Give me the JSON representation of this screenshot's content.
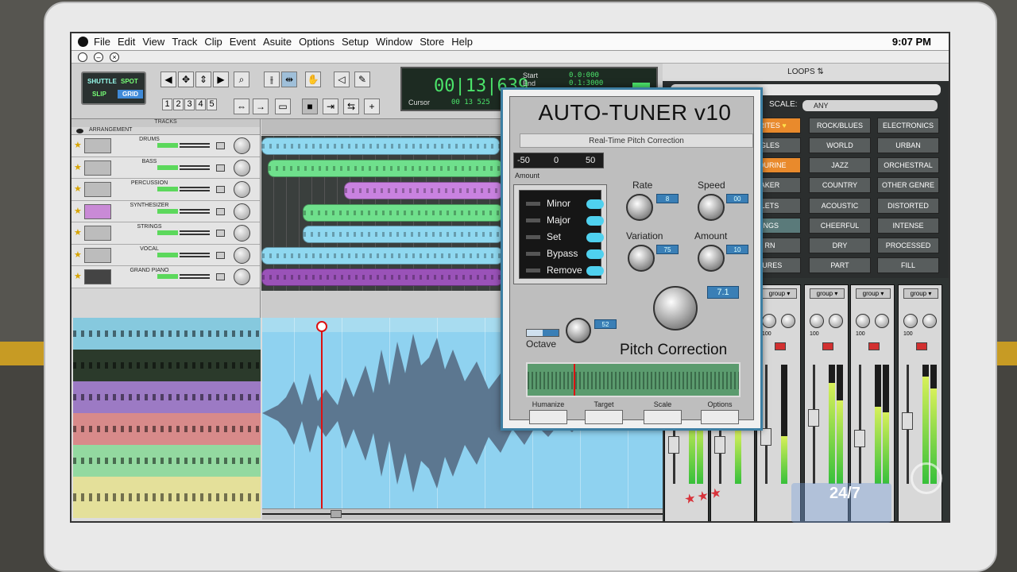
{
  "menubar": {
    "items": [
      "File",
      "Edit",
      "View",
      "Track",
      "Clip",
      "Event",
      "Asuite",
      "Options",
      "Setup",
      "Window",
      "Store",
      "Help"
    ],
    "clock": "9:07 PM"
  },
  "toolbar": {
    "modes": [
      "SHUTTLE",
      "SPOT",
      "SLIP",
      "GRID"
    ],
    "numbers": [
      "1",
      "2",
      "3",
      "4",
      "5"
    ],
    "lcd": {
      "main": "00|13|639",
      "start_label": "Start",
      "end_label": "End",
      "cursor_label": "Cursor"
    }
  },
  "tracks": {
    "header": "TRACKS",
    "arrangement_label": "ARRANGEMENT",
    "items": [
      {
        "name": "DRUMS"
      },
      {
        "name": "BASS"
      },
      {
        "name": "PERCUSSION"
      },
      {
        "name": "SYNTHESIZER"
      },
      {
        "name": "STRINGS"
      },
      {
        "name": "VOCAL"
      },
      {
        "name": "GRAND PIANO"
      }
    ]
  },
  "loops": {
    "title": "LOOPS",
    "scale_label": "SCALE:",
    "scale_value": "ANY",
    "col1": [
      "ORITES",
      "GLES",
      "BOURINE",
      "AKER",
      "LETS",
      "INGS",
      "RN",
      "TURES"
    ],
    "col2": [
      "ROCK/BLUES",
      "WORLD",
      "JAZZ",
      "COUNTRY",
      "ACOUSTIC",
      "CHEERFUL",
      "DRY",
      "PART"
    ],
    "col3": [
      "ELECTRONICS",
      "URBAN",
      "ORCHESTRAL",
      "OTHER GENRE",
      "DISTORTED",
      "INTENSE",
      "PROCESSED",
      "FILL"
    ]
  },
  "mixer": {
    "group_label": "group",
    "pan_values": [
      "100",
      "100",
      "100",
      "100"
    ]
  },
  "plugin": {
    "title": "AUTO-TUNER v10",
    "subtitle": "Real-Time Pitch Correction",
    "amount_min": "-50",
    "amount_val": "0",
    "amount_max": "50",
    "amount_label": "Amount",
    "modes": [
      "Minor",
      "Major",
      "Set",
      "Bypass",
      "Remove"
    ],
    "rate_label": "Rate",
    "speed_label": "Speed",
    "variation_label": "Variation",
    "amount2_label": "Amount",
    "octave_label": "Octave",
    "pitch_label": "Pitch Correction",
    "buttons": [
      "Humanize",
      "Target",
      "Scale",
      "Options"
    ]
  },
  "watermark": {
    "network": "24/7"
  },
  "colors": {
    "accent_blue": "#4fd1ef",
    "lcd_green": "#4be36a",
    "clip_blue": "#8fd8f0",
    "clip_green": "#6fe08c",
    "clip_purple": "#c982e0"
  }
}
